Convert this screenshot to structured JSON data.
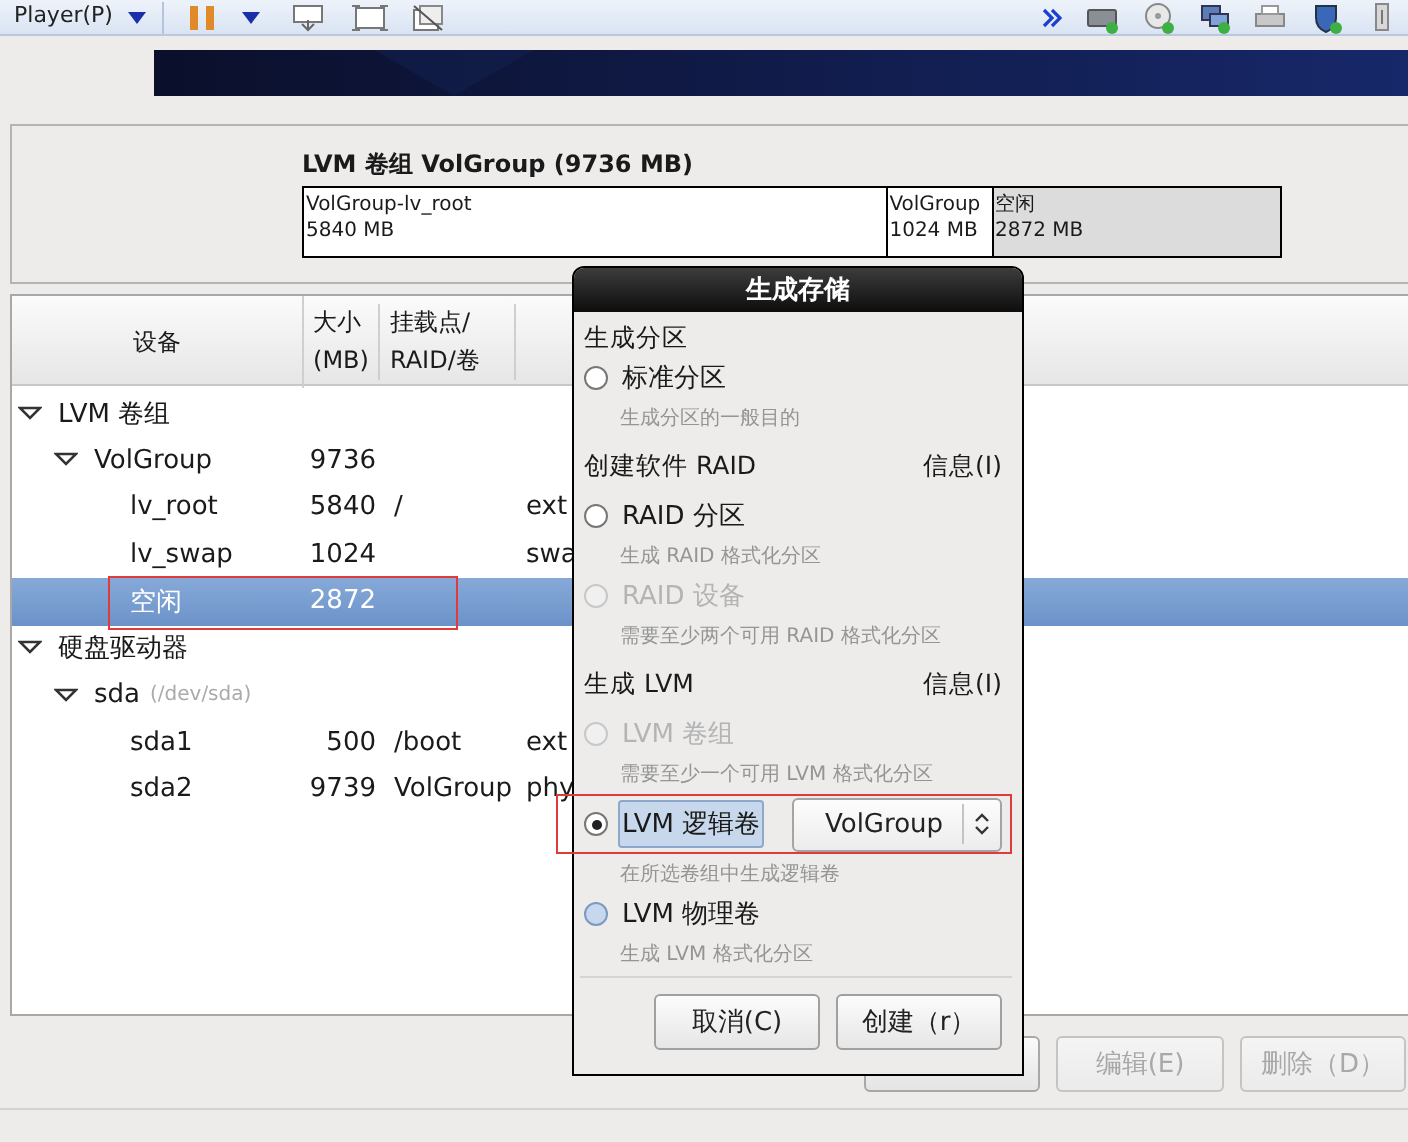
{
  "toolbar": {
    "menu": "Player(P)"
  },
  "lvm_panel": {
    "title": "LVM 卷组 VolGroup (9736 MB)",
    "segments": [
      {
        "kind": "volume",
        "name": "VolGroup-lv_root",
        "size": "5840 MB"
      },
      {
        "kind": "volume",
        "name": "VolGroup",
        "size": "1024 MB"
      },
      {
        "kind": "free",
        "name": "空闲",
        "size": "2872 MB"
      }
    ]
  },
  "tree": {
    "columns": [
      "设备",
      "大小\n(MB)",
      "挂载点/\nRAID/卷"
    ],
    "rows": [
      {
        "name": "LVM 卷组",
        "expanded": true,
        "selected": false,
        "children": [
          {
            "name": "VolGroup",
            "size": "9736",
            "expanded": true,
            "selected": false,
            "children": [
              {
                "name": "lv_root",
                "size": "5840",
                "mount": "/",
                "type": "ext",
                "selected": false
              },
              {
                "name": "lv_swap",
                "size": "1024",
                "type": "swa",
                "selected": false
              },
              {
                "name": "空闲",
                "size": "2872",
                "selected": true,
                "marked": true
              }
            ]
          }
        ]
      },
      {
        "name": "硬盘驱动器",
        "expanded": true,
        "selected": false,
        "children": [
          {
            "name": "sda",
            "path": "(/dev/sda)",
            "expanded": true,
            "selected": false,
            "children": [
              {
                "name": "sda1",
                "size": "500",
                "mount": "/boot",
                "type": "ext",
                "selected": false
              },
              {
                "name": "sda2",
                "size": "9739",
                "mount": "VolGroup",
                "type": "phy",
                "selected": false
              }
            ]
          }
        ]
      }
    ]
  },
  "buttons": [
    {
      "disabled": false
    },
    {
      "label": "编辑(E)",
      "disabled": true
    },
    {
      "label": "删除（D）",
      "disabled": true
    }
  ],
  "dialog": {
    "title": "生成存储",
    "groups": [
      {
        "title": "生成分区",
        "options": [
          {
            "label": "标准分区",
            "description": "生成分区的一般目的",
            "selected": false,
            "disabled": false,
            "focused": false
          }
        ]
      },
      {
        "title": "创建软件 RAID",
        "info": "信息(I)",
        "options": [
          {
            "label": "RAID 分区",
            "description": "生成 RAID 格式化分区",
            "selected": false,
            "disabled": false,
            "focused": false
          },
          {
            "label": "RAID 设备",
            "description": "需要至少两个可用 RAID 格式化分区",
            "selected": false,
            "disabled": true,
            "focused": false
          }
        ]
      },
      {
        "title": "生成 LVM",
        "info": "信息(I)",
        "options": [
          {
            "label": "LVM 卷组",
            "description": "需要至少一个可用 LVM 格式化分区",
            "selected": false,
            "disabled": true,
            "focused": false
          },
          {
            "label": "LVM 逻辑卷",
            "description": "在所选卷组中生成逻辑卷",
            "selected": true,
            "disabled": false,
            "focused": true,
            "marked": true,
            "dropdown": "VolGroup"
          },
          {
            "label": "LVM 物理卷",
            "description": "生成 LVM 格式化分区",
            "selected": false,
            "disabled": false,
            "focused": false,
            "hover": true
          }
        ]
      }
    ],
    "buttons": [
      "取消(C)",
      "创建（r）"
    ]
  }
}
